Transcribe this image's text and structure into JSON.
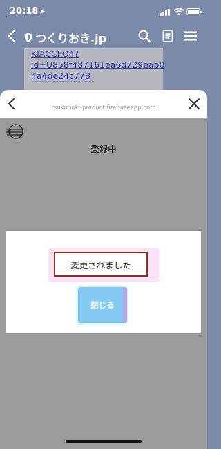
{
  "status_bar": {
    "time": "20:18",
    "location_icon": "location-arrow-icon"
  },
  "browser_nav": {
    "title": "つくりおき.jp"
  },
  "background_page": {
    "link_text": "KIACCFQ4?\nid=U858f487161ea6d729eab04a4de24c778",
    "divider": "-----------------------"
  },
  "sheet": {
    "url": "tsukurioki-product.firebaseapp.com",
    "heading": "登録中"
  },
  "modal": {
    "message": "変更されました",
    "close_label": "閉じる"
  },
  "colors": {
    "nav_bg": "#7c8aa9",
    "overlay_bg": "#9b9b9b",
    "button_blue": "#85c9f5",
    "highlight_pink": "#fbe1f5",
    "message_border": "#8a2f1b",
    "link_blue": "#3a3fb5"
  }
}
